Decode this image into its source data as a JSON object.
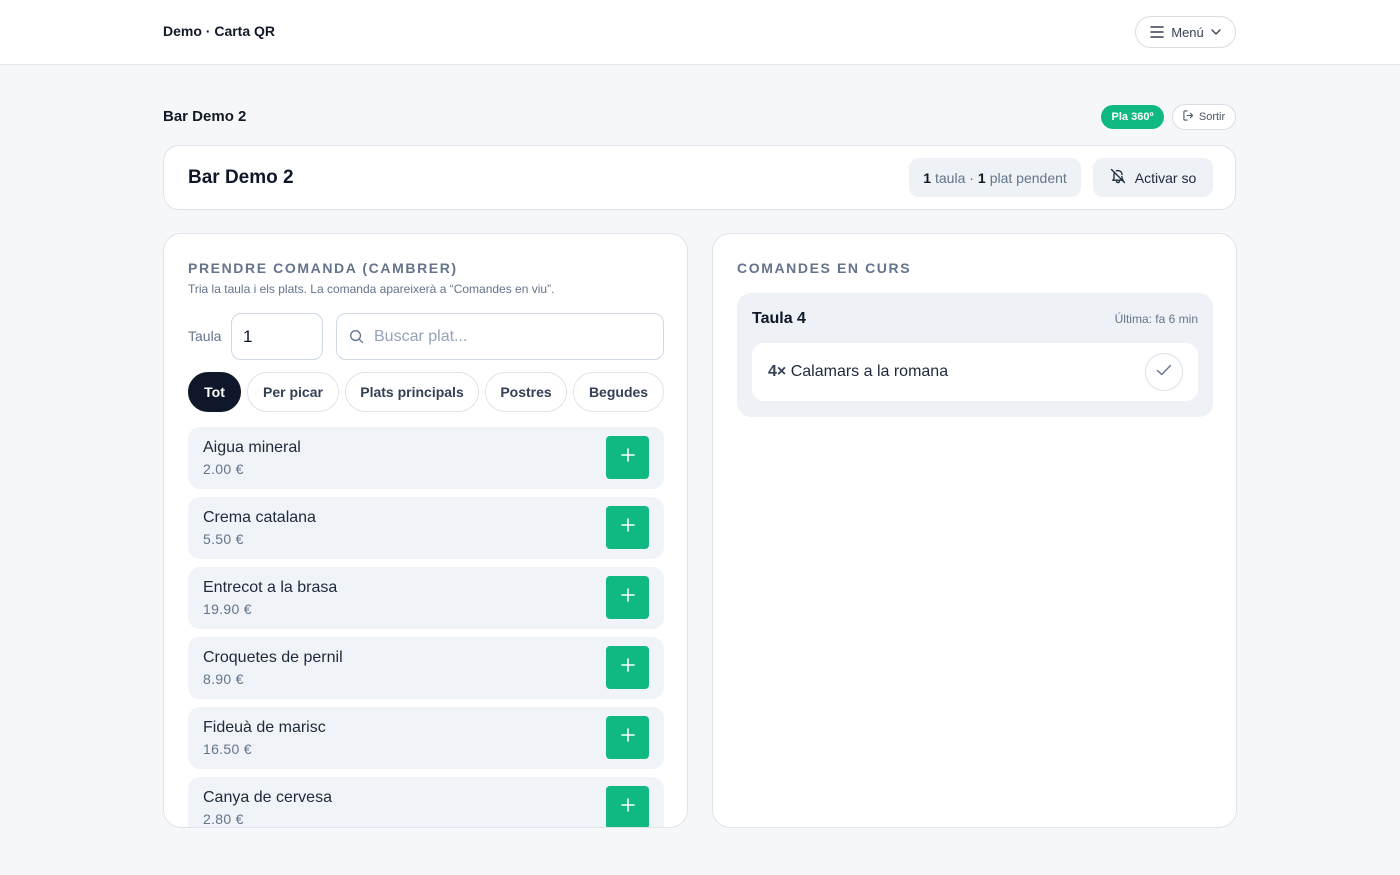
{
  "topbar": {
    "brand": "Demo · Carta QR",
    "menu_label": "Menú"
  },
  "subheader": {
    "venue": "Bar Demo 2",
    "plan_badge": "Pla 360º",
    "exit_label": "Sortir"
  },
  "header_card": {
    "title": "Bar Demo 2",
    "tables_count": "1",
    "tables_word": "taula ·",
    "pending_count": "1",
    "pending_word": "plat pendent",
    "sound_label": "Activar so"
  },
  "order_panel": {
    "heading": "PRENDRE COMANDA (CAMBRER)",
    "subtitle": "Tria la taula i els plats. La comanda apareixerà a “Comandes en viu”.",
    "table_label": "Taula",
    "table_value": "1",
    "search_placeholder": "Buscar plat...",
    "categories": [
      {
        "label": "Tot",
        "active": true
      },
      {
        "label": "Per picar",
        "active": false
      },
      {
        "label": "Plats principals",
        "active": false
      },
      {
        "label": "Postres",
        "active": false
      },
      {
        "label": "Begudes",
        "active": false
      }
    ],
    "items": [
      {
        "name": "Aigua mineral",
        "price": "2.00 €"
      },
      {
        "name": "Crema catalana",
        "price": "5.50 €"
      },
      {
        "name": "Entrecot a la brasa",
        "price": "19.90 €"
      },
      {
        "name": "Croquetes de pernil",
        "price": "8.90 €"
      },
      {
        "name": "Fideuà de marisc",
        "price": "16.50 €"
      },
      {
        "name": "Canya de cervesa",
        "price": "2.80 €"
      }
    ]
  },
  "current_orders": {
    "heading": "COMANDES EN CURS",
    "groups": [
      {
        "table": "Taula 4",
        "last": "Última: fa 6 min",
        "lines": [
          {
            "qty": "4×",
            "dish": "Calamars a la romana"
          }
        ]
      }
    ]
  },
  "colors": {
    "accent_green": "#10b981",
    "dark": "#0f172a",
    "muted": "#64748b"
  }
}
